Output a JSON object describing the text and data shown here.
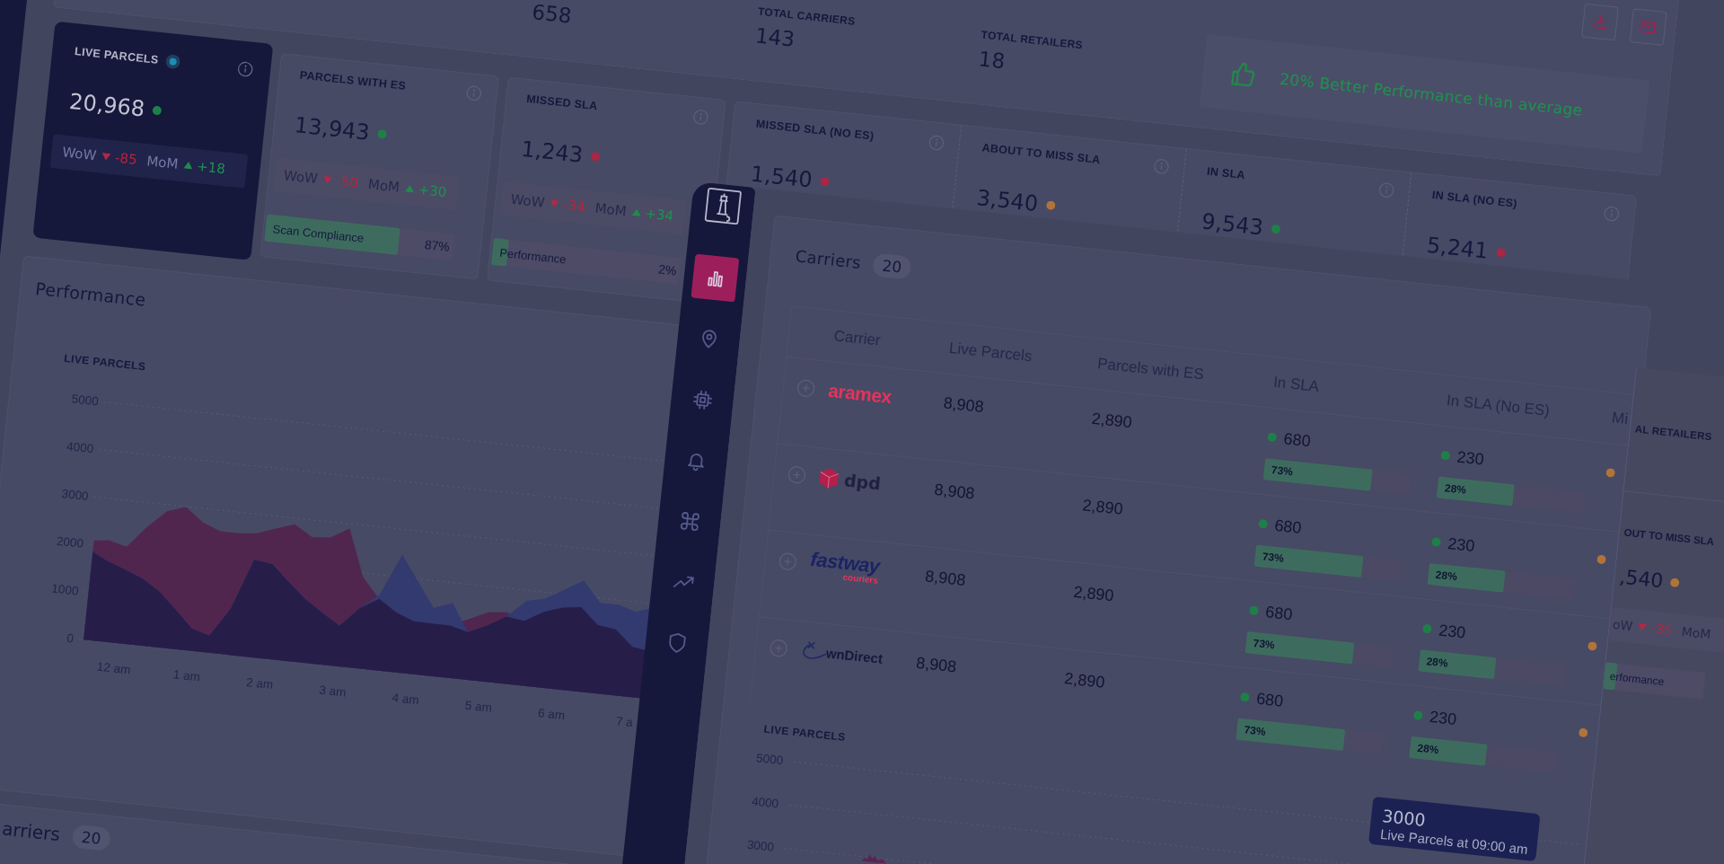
{
  "back_dashboard": {
    "stats": [
      {
        "value": "658"
      },
      {
        "label": "TOTAL CARRIERS",
        "value": "143"
      },
      {
        "label": "TOTAL RETAILERS",
        "value": "18"
      }
    ],
    "banner": {
      "text": "20% Better Performance than average"
    },
    "kpis": [
      {
        "kind": "dark",
        "label": "LIVE PARCELS",
        "value": "20,968",
        "color": "#1e8049",
        "wow": {
          "label": "WoW",
          "value": "-85",
          "rising": false
        },
        "mom": {
          "label": "MoM",
          "value": "+18",
          "rising": true
        }
      },
      {
        "kind": "card",
        "label": "PARCELS WITH ES",
        "value": "13,943",
        "color": "#1e8049",
        "wow": {
          "label": "WoW",
          "value": "-50",
          "rising": false
        },
        "mom": {
          "label": "MoM",
          "value": "+30",
          "rising": true
        },
        "bar": {
          "label": "Scan Compliance",
          "reading": "87%",
          "level": 0.71
        }
      },
      {
        "kind": "card",
        "label": "MISSED SLA",
        "value": "1,243",
        "color": "#a82646",
        "wow": {
          "label": "WoW",
          "value": "-34",
          "rising": false
        },
        "mom": {
          "label": "MoM",
          "value": "+34",
          "rising": true
        },
        "bar": {
          "label": "Performance",
          "reading": "2%",
          "level": 0.08
        }
      },
      {
        "kind": "column",
        "label": "MISSED SLA (NO ES)",
        "value": "1,540",
        "color": "#a82646"
      },
      {
        "kind": "column",
        "label": "ABOUT TO MISS SLA",
        "value": "3,540",
        "color": "#b0743a"
      },
      {
        "kind": "column",
        "label": "IN SLA",
        "value": "9,543",
        "color": "#1e8049"
      },
      {
        "kind": "column",
        "label": "IN SLA (NO ES)",
        "value": "5,241",
        "color": "#a82646"
      }
    ],
    "performance": {
      "title": "Performance",
      "chart": {
        "title": "LIVE PARCELS",
        "y_ticks": [
          "5000",
          "4000",
          "3000",
          "2000",
          "1000",
          "0"
        ],
        "x_labels": [
          "12 am",
          "1 am",
          "2 am",
          "3 am",
          "4 am",
          "5 am",
          "6 am",
          "7 a"
        ]
      }
    },
    "carriers": {
      "title": "arriers",
      "count": "20"
    }
  },
  "front_dashboard": {
    "nav": [
      {
        "kind": "chart",
        "selected": true
      },
      {
        "kind": "pin",
        "selected": false
      },
      {
        "kind": "chip",
        "selected": false
      },
      {
        "kind": "bell",
        "selected": false
      },
      {
        "kind": "command",
        "selected": false
      },
      {
        "kind": "trend",
        "selected": false
      },
      {
        "kind": "shield",
        "selected": false
      }
    ],
    "carriers": {
      "title": "Carriers",
      "count": "20",
      "columns": [
        "Carrier",
        "Live Parcels",
        "Parcels with ES",
        "In SLA",
        "In SLA (No ES)",
        "Mi"
      ],
      "rows": [
        {
          "expanded": false,
          "carrier": {
            "kind": "aramex",
            "name": "aramex"
          },
          "live_parcels": "8,908",
          "parcels_with_es": "2,890",
          "in_sla": {
            "value": "680",
            "color": "#1e8049",
            "reading": "73%",
            "level": 0.73
          },
          "in_sla_no_es": {
            "value": "230",
            "color": "#1e8049",
            "reading": "28%",
            "level": 0.52
          },
          "column_6": {
            "color": "#b0743a"
          }
        },
        {
          "expanded": false,
          "carrier": {
            "kind": "dpd",
            "name": "dpd"
          },
          "live_parcels": "8,908",
          "parcels_with_es": "2,890",
          "in_sla": {
            "value": "680",
            "color": "#1e8049",
            "reading": "73%",
            "level": 0.73
          },
          "in_sla_no_es": {
            "value": "230",
            "color": "#1e8049",
            "reading": "28%",
            "level": 0.52
          },
          "column_6": {
            "color": "#b0743a"
          }
        },
        {
          "expanded": false,
          "carrier": {
            "kind": "fastway",
            "name": "fastway",
            "tagline": "couriers"
          },
          "live_parcels": "8,908",
          "parcels_with_es": "2,890",
          "in_sla": {
            "value": "680",
            "color": "#1e8049",
            "reading": "73%",
            "level": 0.73
          },
          "in_sla_no_es": {
            "value": "230",
            "color": "#1e8049",
            "reading": "28%",
            "level": 0.52
          },
          "column_6": {
            "color": "#b0743a"
          }
        },
        {
          "expanded": false,
          "carrier": {
            "kind": "swoosh",
            "name": "wnDirect"
          },
          "live_parcels": "8,908",
          "parcels_with_es": "2,890",
          "in_sla": {
            "value": "680",
            "color": "#1e8049",
            "reading": "73%",
            "level": 0.73
          },
          "in_sla_no_es": {
            "value": "230",
            "color": "#1e8049",
            "reading": "28%",
            "level": 0.52
          },
          "column_6": {
            "color": "#b0743a"
          }
        }
      ]
    },
    "chart": {
      "title": "LIVE PARCELS",
      "y_ticks": [
        "5000",
        "4000",
        "3000"
      ]
    },
    "tooltip": {
      "value": "3000",
      "text": "Live Parcels at 09:00 am"
    }
  },
  "side_dashboard": {
    "stat_label": "AL RETAILERS",
    "kpi": {
      "label": "OUT TO MISS SLA",
      "value": ",540",
      "color": "#b0743a",
      "wow": {
        "label": "oW",
        "value": "-35",
        "rising": false
      },
      "mom": {
        "label": "MoM"
      },
      "bar": {
        "label": "erformance",
        "level": 0.12
      }
    }
  }
}
